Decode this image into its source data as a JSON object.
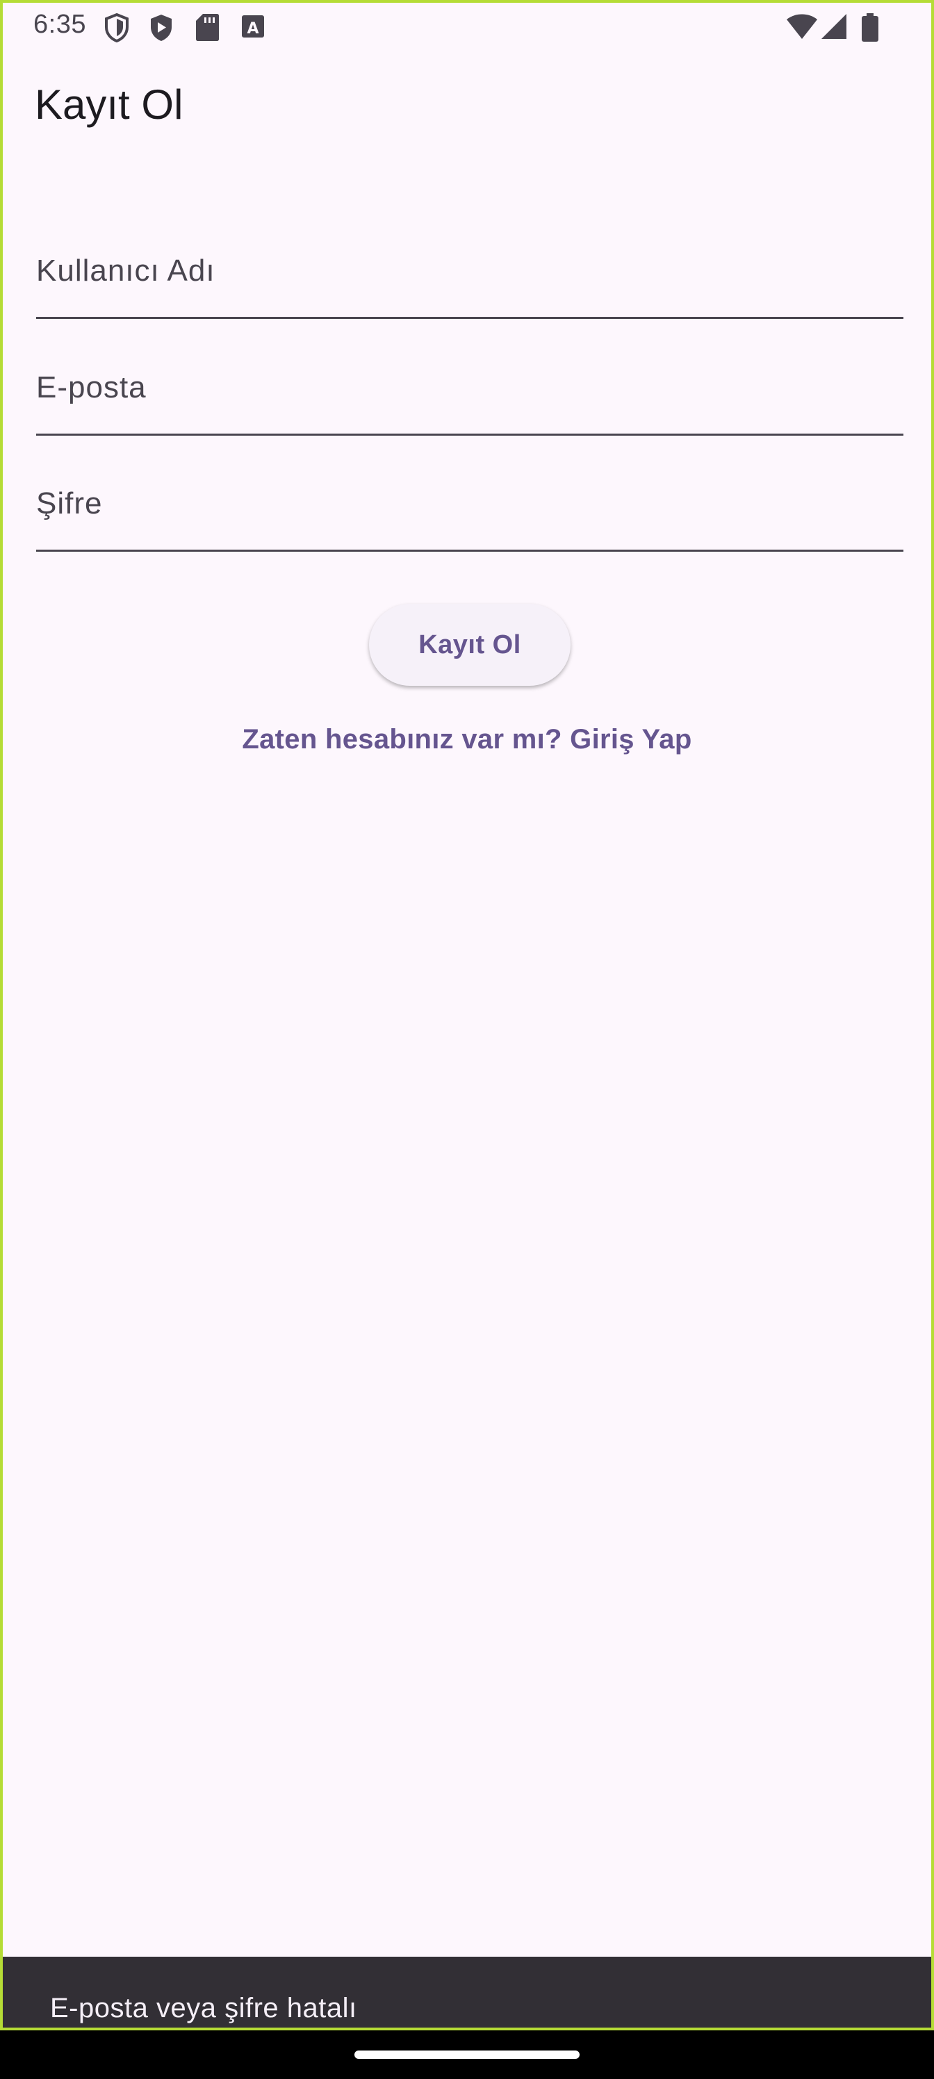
{
  "status_bar": {
    "time": "6:35",
    "icons_left": [
      "shield-outline-icon",
      "play-shield-icon",
      "sd-card-icon",
      "keyboard-a-icon"
    ],
    "icons_right": [
      "wifi-icon",
      "cellular-signal-icon",
      "battery-icon"
    ]
  },
  "app_bar": {
    "title": "Kayıt Ol"
  },
  "form": {
    "username_label": "Kullanıcı Adı",
    "email_label": "E-posta",
    "password_label": "Şifre",
    "register_button": "Kayıt Ol",
    "login_link": "Zaten hesabınız var mı? Giriş Yap"
  },
  "snackbar": {
    "message": "E-posta veya şifre hatalı"
  },
  "colors": {
    "background": "#fdf7fd",
    "accent": "#65558f",
    "snackbar": "#322f35",
    "frame": "#b5dc36"
  }
}
